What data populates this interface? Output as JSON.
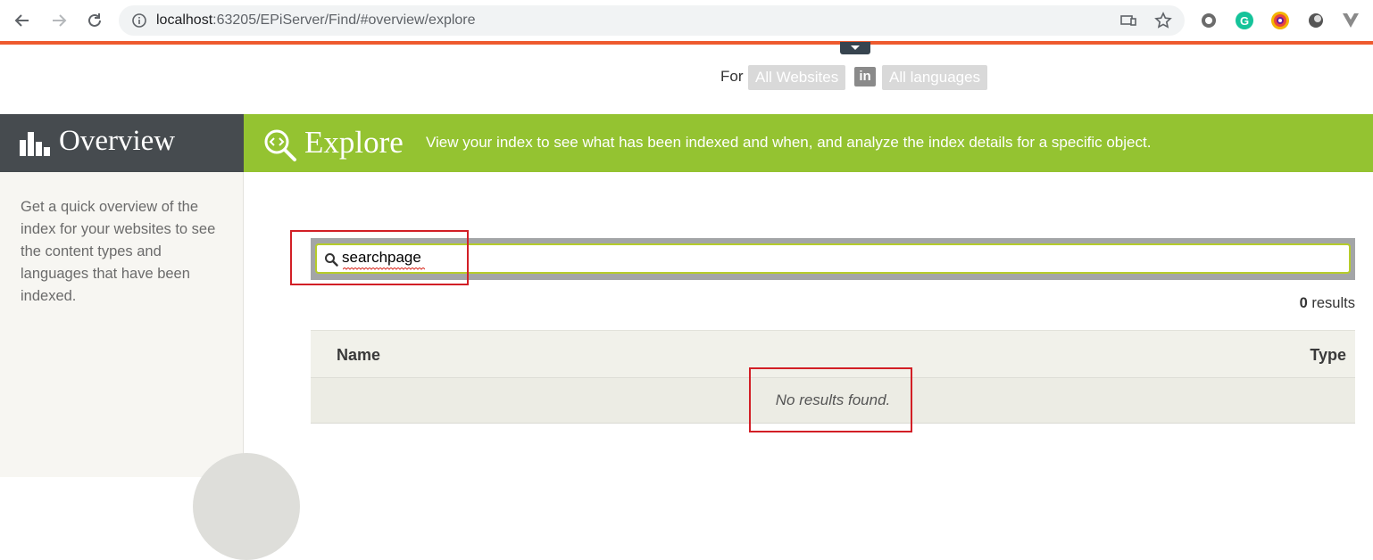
{
  "browser": {
    "url_host": "localhost",
    "url_path": ":63205/EPiServer/Find/#overview/explore"
  },
  "filter": {
    "for_label": "For",
    "websites": "All Websites",
    "in_label": "in",
    "languages": "All languages"
  },
  "overview": {
    "title": "Overview",
    "description": "Get a quick overview of the index for your websites to see the content types and languages that have been indexed."
  },
  "explore": {
    "title": "Explore",
    "description": "View your index to see what has been indexed and when, and analyze the index details for a specific object."
  },
  "search": {
    "value": "searchpage"
  },
  "results": {
    "count": "0",
    "label": "results"
  },
  "table": {
    "columns": [
      "Name",
      "Type"
    ],
    "empty_message": "No results found."
  },
  "colors": {
    "accent_orange": "#ee5a2e",
    "explore_green": "#94c331",
    "overview_dark": "#464b4f",
    "highlight_red": "#d21f26"
  }
}
